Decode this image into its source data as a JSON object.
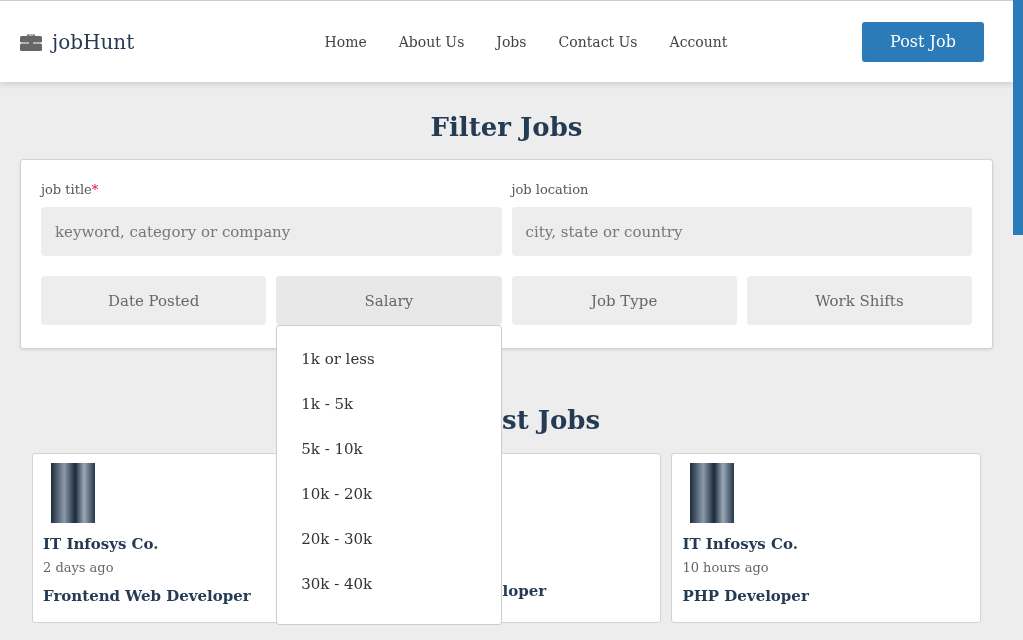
{
  "brand": {
    "name": "jobHunt"
  },
  "nav": [
    {
      "label": "Home"
    },
    {
      "label": "About Us"
    },
    {
      "label": "Jobs"
    },
    {
      "label": "Contact Us"
    },
    {
      "label": "Account"
    }
  ],
  "post_button": "Post Job",
  "filter": {
    "title": "Filter Jobs",
    "fields": [
      {
        "label": "job title",
        "required_mark": "*",
        "placeholder": "keyword, category or company"
      },
      {
        "label": "job location",
        "placeholder": "city, state or country"
      }
    ],
    "dropdowns": [
      {
        "label": "Date Posted",
        "expanded": false
      },
      {
        "label": "Salary",
        "expanded": true,
        "options": [
          "1k or less",
          "1k - 5k",
          "5k - 10k",
          "10k - 20k",
          "20k - 30k",
          "30k - 40k"
        ]
      },
      {
        "label": "Job Type",
        "expanded": false
      },
      {
        "label": "Work Shifts",
        "expanded": false
      }
    ]
  },
  "latest": {
    "title": "st Jobs",
    "cards": [
      {
        "kind": "full",
        "company": "IT Infosys Co.",
        "posted": "2 days ago",
        "title": "Frontend Web Developer"
      },
      {
        "kind": "covered",
        "title": "loper"
      },
      {
        "kind": "full",
        "company": "IT Infosys Co.",
        "posted": "10 hours ago",
        "title": "PHP Developer"
      }
    ]
  }
}
